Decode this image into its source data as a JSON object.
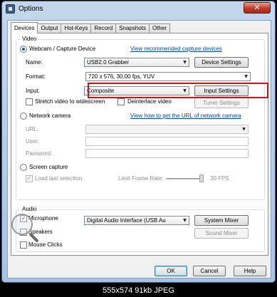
{
  "window": {
    "title": "Options",
    "close_glyph": "✕"
  },
  "tabs": [
    {
      "label": "Devices"
    },
    {
      "label": "Output"
    },
    {
      "label": "Hot-Keys"
    },
    {
      "label": "Record"
    },
    {
      "label": "Snapshots"
    },
    {
      "label": "Other"
    }
  ],
  "video": {
    "group_label": "Video",
    "webcam": {
      "label": "Webcam / Capture Device",
      "link": "View recommended capture devices",
      "name_label": "Name:",
      "name_value": "USB2.0 Grabber",
      "device_settings": "Device Settings",
      "format_label": "Format:",
      "format_value": "720 x 576, 30.00 fps, YUV",
      "input_label": "Input:",
      "input_value": "Composite",
      "input_settings": "Input Settings",
      "stretch_label": "Stretch video to widescreen",
      "deinterlace_label": "Deinterlace video",
      "tuner_settings": "Tuner Settings"
    },
    "network": {
      "label": "Network camera",
      "link": "View how to get the URL of network camera",
      "url_label": "URL:",
      "user_label": "User:",
      "password_label": "Password:"
    },
    "screen": {
      "label": "Screen capture",
      "load_last_label": "Load last selection",
      "limit_label": "Limit Frame Rate:",
      "fps_value": "30 FPS"
    }
  },
  "audio": {
    "group_label": "Audio",
    "microphone_label": "Microphone",
    "microphone_device": "Digital Audio Interface (USB Au",
    "system_mixer": "System Mixer",
    "speakers_label": "Speakers",
    "sound_mixer": "Sound Mixer",
    "mouse_clicks_label": "Mouse Clicks"
  },
  "footer": {
    "ok": "OK",
    "cancel": "Cancel",
    "help": "Help"
  },
  "status_text": "555x574  91kb  JPEG",
  "icons": {
    "combo_arrow": "▼",
    "check": "✓"
  },
  "colors": {
    "highlight_border": "#c9141b",
    "link": "#0645ad"
  }
}
